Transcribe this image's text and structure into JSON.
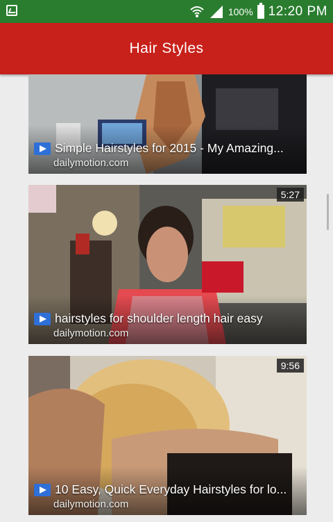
{
  "status_bar": {
    "battery_percent": "100%",
    "time": "12:20 PM"
  },
  "app_bar": {
    "title": "Hair Styles"
  },
  "videos": [
    {
      "title": "Simple Hairstyles for 2015 - My Amazing...",
      "source": "dailymotion.com",
      "duration": ""
    },
    {
      "title": "hairstyles for shoulder length hair easy",
      "source": "dailymotion.com",
      "duration": "5:27"
    },
    {
      "title": "10 Easy, Quick Everyday Hairstyles for lo...",
      "source": "dailymotion.com",
      "duration": "9:56"
    }
  ],
  "colors": {
    "status_bar": "#2a7d2f",
    "app_bar": "#c8201a",
    "play_badge": "#2e6fd8",
    "background": "#ececec"
  },
  "icons": [
    "screenshot-notification-icon",
    "wifi-icon",
    "signal-icon",
    "battery-icon",
    "play-icon"
  ]
}
